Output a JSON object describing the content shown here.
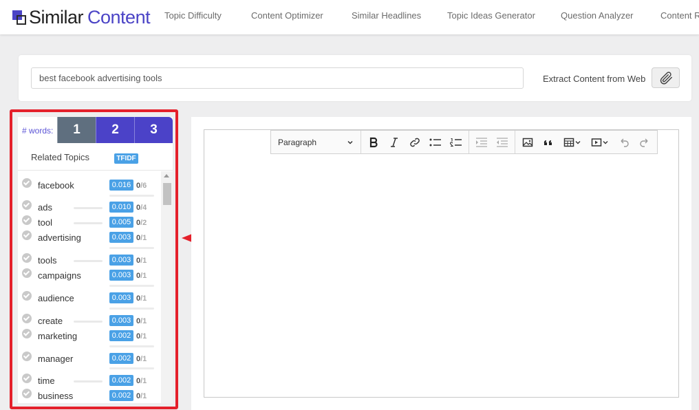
{
  "brand": {
    "part1": "Similar",
    "part2": "Content"
  },
  "nav": [
    "Topic Difficulty",
    "Content Optimizer",
    "Similar Headlines",
    "Topic Ideas Generator",
    "Question Analyzer",
    "Content R"
  ],
  "search": {
    "value": "best facebook advertising tools",
    "extract_label": "Extract Content from Web"
  },
  "words": {
    "label": "# words:",
    "tabs": [
      "1",
      "2",
      "3"
    ]
  },
  "related": {
    "label": "Related Topics",
    "badge": "TFIDF"
  },
  "topics": [
    {
      "name": "facebook",
      "score": "0.016",
      "used": "0",
      "total": "/6"
    },
    {
      "name": "ads",
      "score": "0.010",
      "used": "0",
      "total": "/4"
    },
    {
      "name": "tool",
      "score": "0.005",
      "used": "0",
      "total": "/2"
    },
    {
      "name": "advertising",
      "score": "0.003",
      "used": "0",
      "total": "/1"
    },
    {
      "name": "tools",
      "score": "0.003",
      "used": "0",
      "total": "/1"
    },
    {
      "name": "campaigns",
      "score": "0.003",
      "used": "0",
      "total": "/1"
    },
    {
      "name": "audience",
      "score": "0.003",
      "used": "0",
      "total": "/1"
    },
    {
      "name": "create",
      "score": "0.003",
      "used": "0",
      "total": "/1"
    },
    {
      "name": "marketing",
      "score": "0.002",
      "used": "0",
      "total": "/1"
    },
    {
      "name": "manager",
      "score": "0.002",
      "used": "0",
      "total": "/1"
    },
    {
      "name": "time",
      "score": "0.002",
      "used": "0",
      "total": "/1"
    },
    {
      "name": "business",
      "score": "0.002",
      "used": "0",
      "total": "/1"
    }
  ],
  "editor": {
    "paragraph": "Paragraph"
  },
  "colors": {
    "brand": "#4b44c6",
    "badge": "#4aa1e6",
    "highlight": "#e4202b",
    "tab_inactive": "#5f6f7f"
  }
}
